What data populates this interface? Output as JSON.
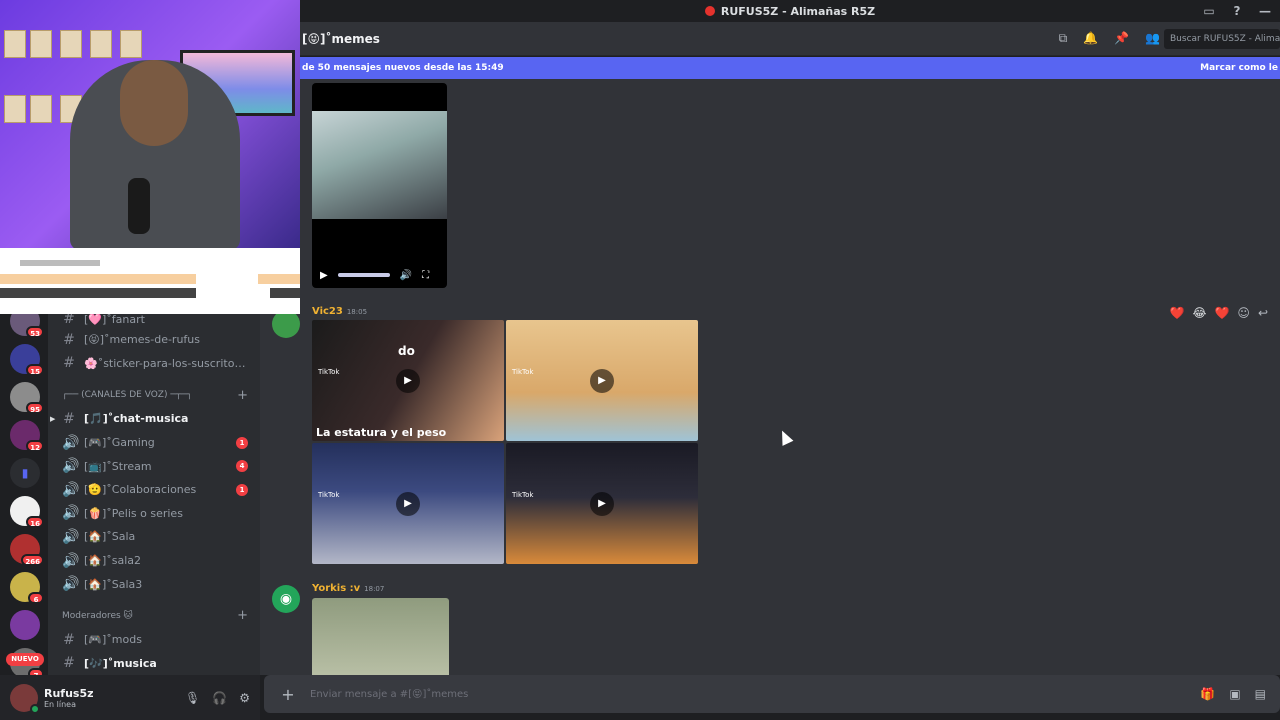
{
  "window": {
    "title": "RUFUS5Z - Alimañas R5Z",
    "title_color": "#e5322d"
  },
  "chat_header": {
    "channel": "[😝]˚memes",
    "icons": [
      "threads-icon",
      "bell-icon",
      "pin-icon",
      "members-icon"
    ],
    "search_placeholder": "Buscar RUFUS5Z - Alimañas"
  },
  "new_messages_banner": {
    "text": "de 50 mensajes nuevos desde las 15:49",
    "action": "Marcar como le",
    "color": "#5865f2"
  },
  "rail": {
    "badges": [
      "53",
      "15",
      "95",
      "12",
      "16",
      "266",
      "6",
      "7"
    ],
    "nuevo_label": "NUEVO"
  },
  "sidebar": {
    "channels_top": [
      {
        "name": "[🩷]˚fanart",
        "icon": "hash"
      },
      {
        "name": "[😝]˚memes-de-rufus",
        "icon": "hash"
      },
      {
        "name": "🌸˚sticker-para-los-suscritores...",
        "icon": "hash"
      }
    ],
    "voice_category": "┌── (CANALES DE VOZ) ─┬─┐",
    "voice_channels": [
      {
        "name": "[🎵]˚chat-musica",
        "icon": "hash",
        "active": true,
        "badge": ""
      },
      {
        "name": "[🎮]˚Gaming",
        "icon": "speaker",
        "badge": "1"
      },
      {
        "name": "[📺]˚Stream",
        "icon": "speaker",
        "badge": "4"
      },
      {
        "name": "[🫡]˚Colaboraciones",
        "icon": "speaker",
        "badge": "1"
      },
      {
        "name": "[🍿]˚Pelis o series",
        "icon": "speaker",
        "badge": ""
      },
      {
        "name": "[🏠]˚Sala",
        "icon": "speaker",
        "badge": ""
      },
      {
        "name": "[🏠]˚sala2",
        "icon": "speaker",
        "badge": ""
      },
      {
        "name": "[🏠]˚Sala3",
        "icon": "speaker",
        "badge": ""
      }
    ],
    "mod_category": "Moderadores 🐱",
    "mod_channels": [
      {
        "name": "[🎮]˚mods",
        "icon": "hash"
      },
      {
        "name": "[🎶]˚musica",
        "icon": "hash",
        "active": true
      }
    ]
  },
  "user_panel": {
    "name": "Rufus5z",
    "status": "En línea"
  },
  "messages": [
    {
      "author": "Vic23",
      "time": "18:05",
      "author_color": "#f0b232",
      "tiles": [
        {
          "source": "TikTok",
          "caption": "La estatura y el peso",
          "overlay": "do"
        },
        {
          "source": "TikTok",
          "caption": "",
          "overlay": ""
        },
        {
          "source": "TikTok",
          "caption": "",
          "overlay": ""
        },
        {
          "source": "TikTok",
          "caption": "",
          "overlay": ""
        }
      ],
      "reactions": [
        "❤️",
        "😂",
        "❤️"
      ]
    },
    {
      "author": "Yorkis :v",
      "time": "18:07",
      "author_color": "#f0b232"
    }
  ],
  "composer": {
    "placeholder": "Enviar mensaje a #[😝]˚memes"
  }
}
